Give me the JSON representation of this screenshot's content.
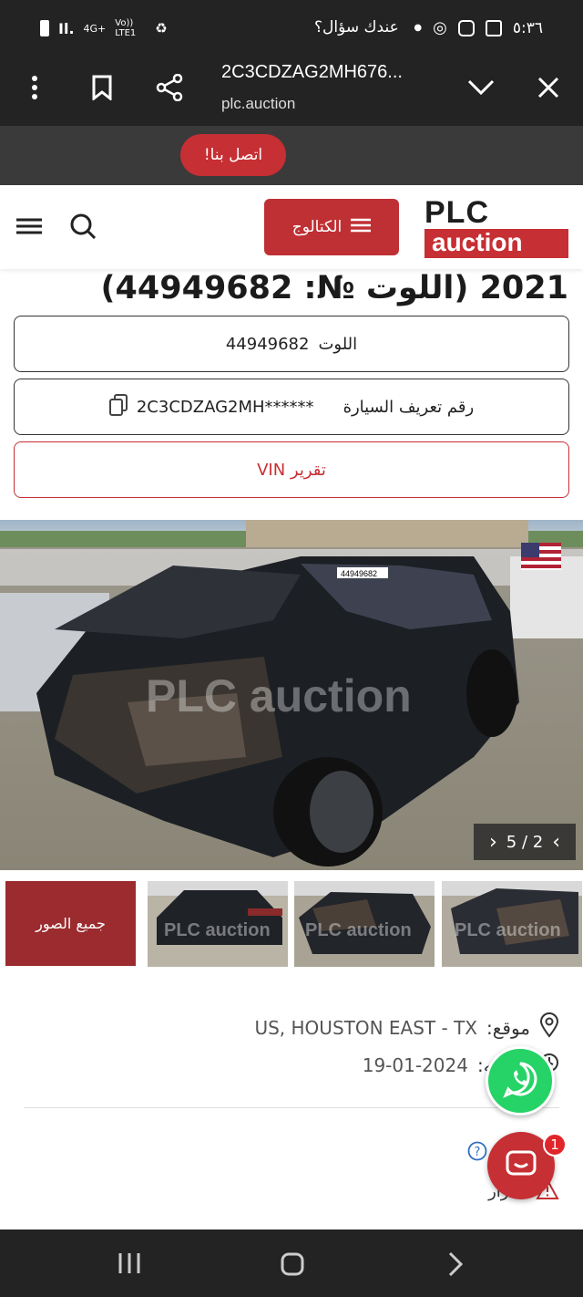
{
  "status_bar": {
    "time": "٥:٣٦",
    "network": "4G+",
    "volte": "Vo)) LTE1"
  },
  "browser": {
    "page_title": "2C3CDZAG2MH676...",
    "domain": "plc.auction"
  },
  "promo": {
    "question": "عندك سؤال؟",
    "contact_label": "اتصل بنا!"
  },
  "header": {
    "catalog_label": "الكتالوج",
    "logo_top": "PLC",
    "logo_bottom": "auction"
  },
  "lot": {
    "title": "2021 (اللوت №: 44949682)",
    "lot_label": "اللوت",
    "lot_number": "44949682",
    "vin_label": "رقم تعريف السيارة",
    "vin_value": "2C3CDZAG2MH******",
    "vin_report_label": "تقرير VIN"
  },
  "gallery": {
    "watermark": "PLC auction",
    "counter": "5 / 2",
    "all_photos_label": "جميع الصور",
    "plate_text": "44949682"
  },
  "details": {
    "location_label": "موقع:",
    "location_value": "US, HOUSTON EAST - TX",
    "updated_label": "تحديثه:",
    "updated_value": "19-01-2024",
    "damage_label": "أضرار"
  },
  "chat": {
    "badge_count": "1"
  },
  "colors": {
    "brand_red": "#c62f33",
    "dark_bar": "#232323",
    "whatsapp_green": "#25d366"
  }
}
